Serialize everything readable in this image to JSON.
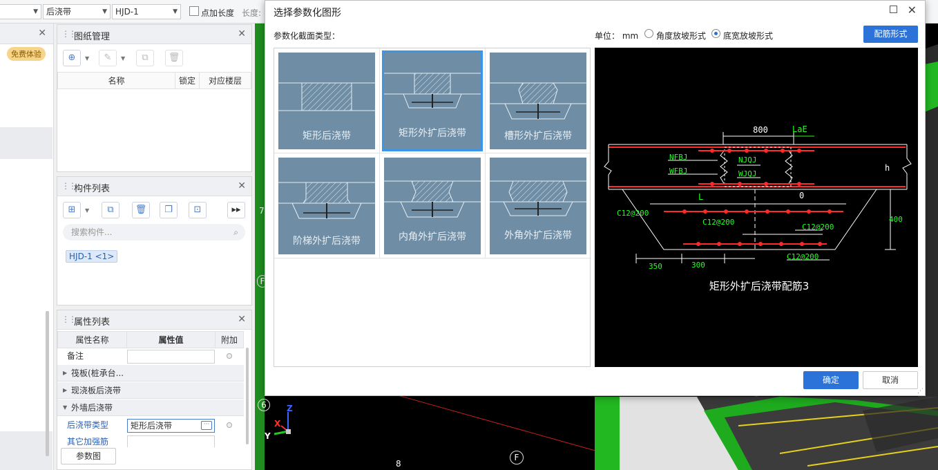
{
  "toolbar": {
    "select1_value": "后浇带",
    "select2_value": "HJD-1",
    "checkbox_label": "点加长度",
    "length_label": "长度:"
  },
  "left_strip": {
    "badge": "免费体验"
  },
  "drawing_panel": {
    "title": "图纸管理",
    "columns": [
      "名称",
      "锁定",
      "对应楼层"
    ]
  },
  "component_panel": {
    "title": "构件列表",
    "search_placeholder": "搜索构件...",
    "items": [
      "HJD-1 <1>"
    ]
  },
  "property_panel": {
    "title": "属性列表",
    "columns": [
      "属性名称",
      "属性值",
      "附加"
    ],
    "rows": [
      {
        "name": "备注",
        "value": ""
      },
      {
        "group": "筏板(桩承台..."
      },
      {
        "group": "现浇板后浇带"
      },
      {
        "group": "外墙后浇带"
      },
      {
        "name": "后浇带类型",
        "value": "矩形后浇带"
      },
      {
        "name": "其它加强筋",
        "value": ""
      }
    ],
    "param_button": "参数图"
  },
  "canvas": {
    "axis_labels": [
      "6",
      "F",
      "F",
      "7",
      "8"
    ],
    "axes": {
      "x": "X",
      "y": "Y",
      "z": "Z"
    }
  },
  "dialog": {
    "title": "选择参数化图形",
    "section_label": "参数化截面类型：",
    "unit_label": "单位： mm",
    "radio_angle": "角度放坡形式",
    "radio_width": "底宽放坡形式",
    "radio_selected": "底宽放坡形式",
    "config_button": "配筋形式",
    "ok_button": "确定",
    "cancel_button": "取消",
    "shapes": [
      "矩形后浇带",
      "矩形外扩后浇带",
      "槽形外扩后浇带",
      "阶梯外扩后浇带",
      "内角外扩后浇带",
      "外角外扩后浇带"
    ],
    "selected_shape": "矩形外扩后浇带",
    "preview": {
      "caption": "矩形外扩后浇带配筋3",
      "labels": {
        "top_width": "800",
        "lae": "LaE",
        "nfbj": "NFBJ",
        "wfbj": "WFBJ",
        "njqj": "NJQJ",
        "wjqj": "WJQJ",
        "h": "h",
        "l": "L",
        "zero": "0",
        "c1": "C12@200",
        "c2": "C12@200",
        "c3": "C12@200",
        "c4": "C12@200",
        "depth": "400",
        "d350": "350",
        "d300": "300"
      }
    }
  }
}
